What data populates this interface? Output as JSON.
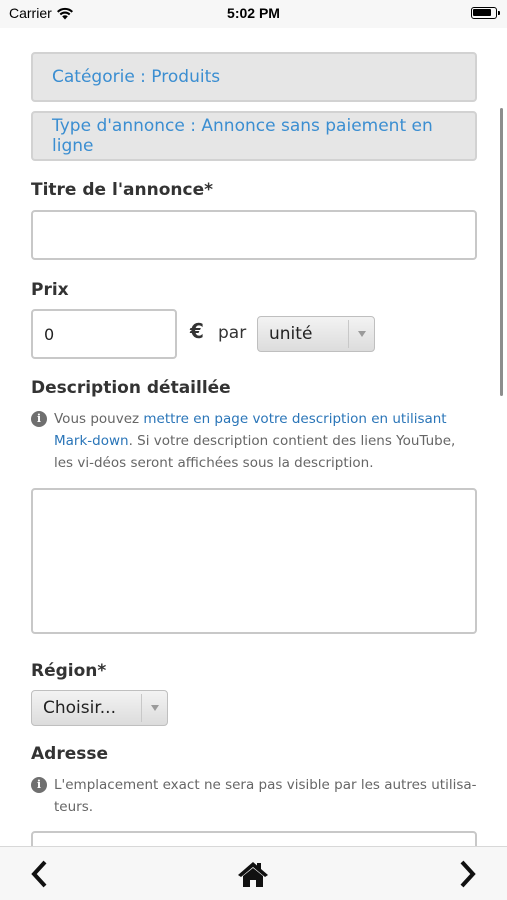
{
  "status_bar": {
    "carrier": "Carrier",
    "time": "5:02 PM",
    "battery_level": 0.85
  },
  "form": {
    "category_box": "Catégorie : Produits",
    "type_box": "Type d'annonce : Annonce sans paiement en ligne",
    "title_label": "Titre de l'annonce*",
    "title_value": "",
    "price_label": "Prix",
    "price_value": "0",
    "currency_symbol": "€",
    "per_label": "par",
    "unit_select": "unité",
    "description_label": "Description détaillée",
    "description_hint": {
      "before": "Vous pouvez ",
      "link": "mettre en page votre description en utilisant Mark-down",
      "after": ". Si votre description contient des liens YouTube, les vi-déos seront affichées sous la description."
    },
    "description_value": "",
    "region_label": "Région*",
    "region_select": "Choisir...",
    "address_label": "Adresse",
    "address_hint": "L'emplacement exact ne sera pas visible par les autres utilisa-teurs."
  },
  "toolbar": {
    "back_icon": "chevron-left-icon",
    "home_icon": "home-icon",
    "forward_icon": "chevron-right-icon"
  },
  "colors": {
    "link": "#2a75b8",
    "info_text": "#3b8ed1",
    "info_bg": "#e6e6e6"
  }
}
